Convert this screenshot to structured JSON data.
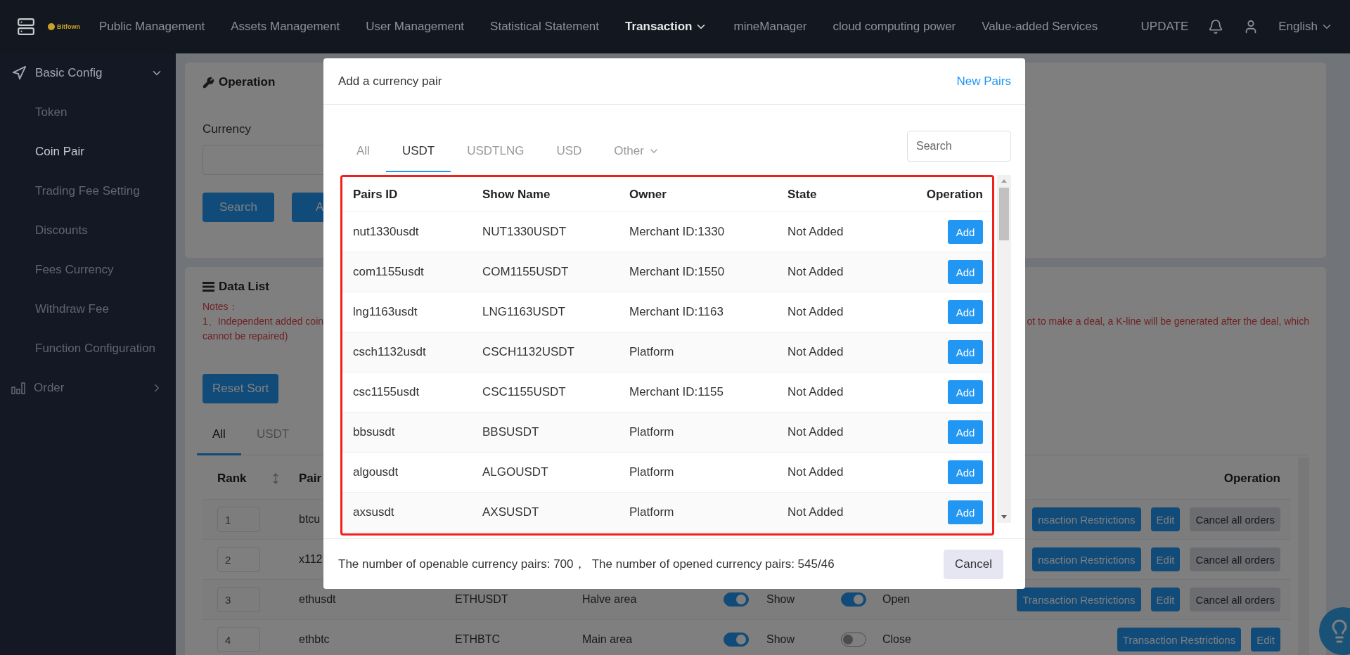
{
  "topbar": {
    "logo": "Bitfown",
    "nav": [
      {
        "label": "Public Management",
        "selected": false,
        "dropdown": false
      },
      {
        "label": "Assets Management",
        "selected": false,
        "dropdown": false
      },
      {
        "label": "User Management",
        "selected": false,
        "dropdown": false
      },
      {
        "label": "Statistical Statement",
        "selected": false,
        "dropdown": false
      },
      {
        "label": "Transaction",
        "selected": true,
        "dropdown": true
      },
      {
        "label": "mineManager",
        "selected": false,
        "dropdown": false
      },
      {
        "label": "cloud computing power",
        "selected": false,
        "dropdown": false
      },
      {
        "label": "Value-added Services",
        "selected": false,
        "dropdown": false
      }
    ],
    "update": "UPDATE",
    "language": "English"
  },
  "sidebar": {
    "groups": [
      {
        "label": "Basic Config",
        "expanded": true,
        "children": [
          {
            "label": "Token",
            "selected": false
          },
          {
            "label": "Coin Pair",
            "selected": true
          },
          {
            "label": "Trading Fee Setting",
            "selected": false
          },
          {
            "label": "Discounts",
            "selected": false
          },
          {
            "label": "Fees Currency",
            "selected": false
          },
          {
            "label": "Withdraw Fee",
            "selected": false
          },
          {
            "label": "Function Configuration",
            "selected": false
          }
        ]
      },
      {
        "label": "Order",
        "expanded": false
      }
    ]
  },
  "operation_panel": {
    "title": "Operation",
    "currency_label": "Currency",
    "buttons": [
      "Search",
      "A"
    ]
  },
  "data_list": {
    "title": "Data List",
    "notes": {
      "heading": "Notes：",
      "line_start": "1、Independent added coin",
      "line_end": "ot to make a deal, a K-line will be generated after the deal, which",
      "line_2": "cannot be repaired)"
    },
    "reset_button": "Reset Sort",
    "tabs": [
      {
        "label": "All",
        "selected": true
      },
      {
        "label": "USDT",
        "selected": false
      }
    ],
    "columns": {
      "rank": "Rank",
      "pair": "Pair",
      "operation": "Operation"
    },
    "rows": [
      {
        "rank": "1",
        "pair": "btcu",
        "actions": [
          {
            "label": "nsaction Restrictions",
            "kind": "primary"
          },
          {
            "label": "Edit",
            "kind": "primary"
          },
          {
            "label": "Cancel all orders",
            "kind": "secondary"
          }
        ]
      },
      {
        "rank": "2",
        "pair": "x112",
        "actions": [
          {
            "label": "nsaction Restrictions",
            "kind": "primary"
          },
          {
            "label": "Edit",
            "kind": "primary"
          },
          {
            "label": "Cancel all orders",
            "kind": "secondary"
          }
        ]
      },
      {
        "rank": "3",
        "pair": "ethusdt",
        "show_name": "ETHUSDT",
        "area": "Halve area",
        "display_on": true,
        "display_label": "Show",
        "trade_on": true,
        "trade_label": "Open",
        "actions": [
          {
            "label": "Transaction Restrictions",
            "kind": "primary"
          },
          {
            "label": "Edit",
            "kind": "primary"
          },
          {
            "label": "Cancel all orders",
            "kind": "secondary"
          }
        ]
      },
      {
        "rank": "4",
        "pair": "ethbtc",
        "show_name": "ETHBTC",
        "area": "Main area",
        "display_on": true,
        "display_label": "Show",
        "trade_on": false,
        "trade_label": "Close",
        "actions": [
          {
            "label": "Transaction Restrictions",
            "kind": "primary"
          },
          {
            "label": "Edit",
            "kind": "primary"
          }
        ]
      }
    ]
  },
  "modal": {
    "title": "Add a currency pair",
    "link": "New Pairs",
    "tabs": [
      {
        "label": "All",
        "selected": false,
        "dropdown": false
      },
      {
        "label": "USDT",
        "selected": true,
        "dropdown": false
      },
      {
        "label": "USDTLNG",
        "selected": false,
        "dropdown": false
      },
      {
        "label": "USD",
        "selected": false,
        "dropdown": false
      },
      {
        "label": "Other",
        "selected": false,
        "dropdown": true
      }
    ],
    "search": {
      "placeholder": "Search"
    },
    "columns": [
      "Pairs ID",
      "Show Name",
      "Owner",
      "State",
      "Operation"
    ],
    "rows": [
      {
        "pair_id": "nut1330usdt",
        "show_name": "NUT1330USDT",
        "owner": "Merchant ID:1330",
        "state": "Not Added",
        "action": "Add"
      },
      {
        "pair_id": "com1155usdt",
        "show_name": "COM1155USDT",
        "owner": "Merchant ID:1550",
        "state": "Not Added",
        "action": "Add"
      },
      {
        "pair_id": "lng1163usdt",
        "show_name": "LNG1163USDT",
        "owner": "Merchant ID:1163",
        "state": "Not Added",
        "action": "Add"
      },
      {
        "pair_id": "csch1132usdt",
        "show_name": "CSCH1132USDT",
        "owner": "Platform",
        "state": "Not Added",
        "action": "Add"
      },
      {
        "pair_id": "csc1155usdt",
        "show_name": "CSC1155USDT",
        "owner": "Merchant ID:1155",
        "state": "Not Added",
        "action": "Add"
      },
      {
        "pair_id": "bbsusdt",
        "show_name": "BBSUSDT",
        "owner": "Platform",
        "state": "Not Added",
        "action": "Add"
      },
      {
        "pair_id": "algousdt",
        "show_name": "ALGOUSDT",
        "owner": "Platform",
        "state": "Not Added",
        "action": "Add"
      },
      {
        "pair_id": "axsusdt",
        "show_name": "AXSUSDT",
        "owner": "Platform",
        "state": "Not Added",
        "action": "Add"
      }
    ],
    "footer_text": "The number of openable currency pairs: 700，  The number of opened currency pairs: 545/46",
    "cancel": "Cancel"
  }
}
